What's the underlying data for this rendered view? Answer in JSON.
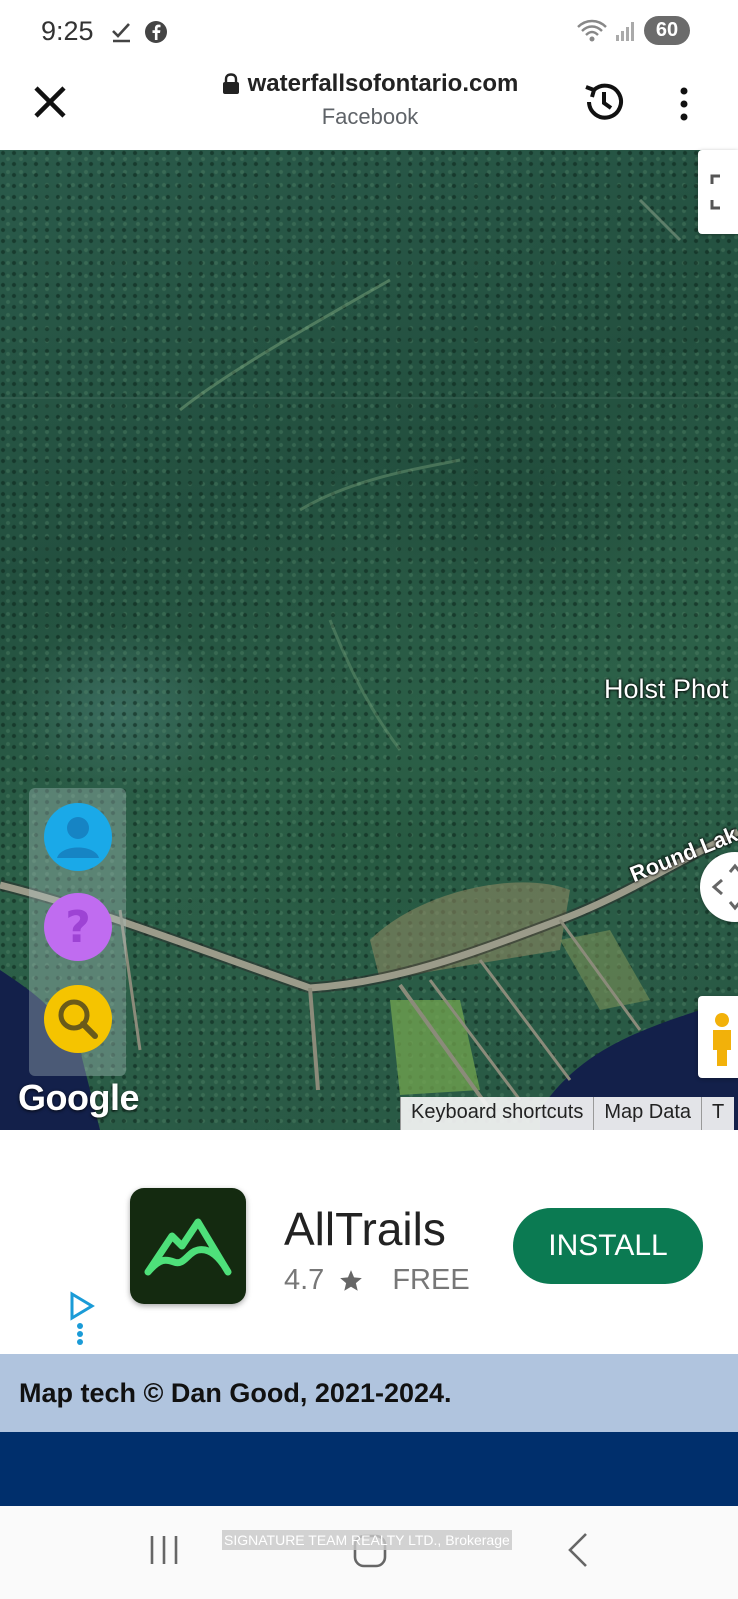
{
  "status_bar": {
    "time": "9:25",
    "battery": "60"
  },
  "browser": {
    "url": "waterfallsofontario.com",
    "subtitle": "Facebook"
  },
  "map": {
    "place_label": "Holst Phot",
    "road_label": "Round Lak",
    "logo": "Google",
    "footer": [
      "Keyboard shortcuts",
      "Map Data",
      "T"
    ]
  },
  "ad": {
    "app_name": "AllTrails",
    "rating": "4.7",
    "price": "FREE",
    "install_label": "INSTALL"
  },
  "credit": "Map tech © Dan Good, 2021-2024.",
  "watermark": "SIGNATURE TEAM REALTY LTD., Brokerage",
  "colors": {
    "install": "#0b7a52",
    "credit_bg": "#b0c4de",
    "navy": "#002f6c"
  }
}
